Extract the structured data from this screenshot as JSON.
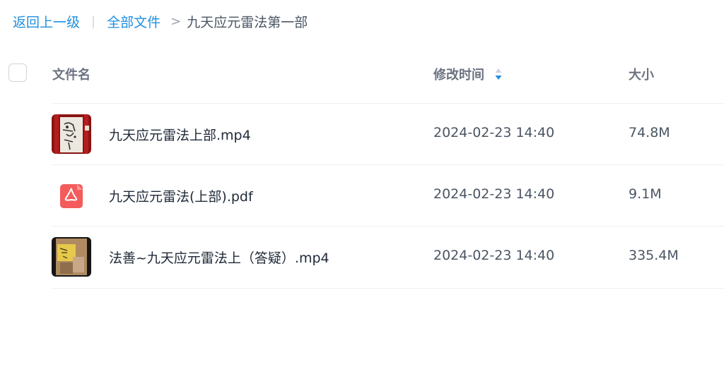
{
  "breadcrumb": {
    "back": "返回上一级",
    "divider": "|",
    "root": "全部文件",
    "separator": ">",
    "current": "九天应元雷法第一部"
  },
  "table": {
    "headers": {
      "name": "文件名",
      "modified": "修改时间",
      "size": "大小"
    },
    "sort_icon": "sort-arrows-icon",
    "rows": [
      {
        "name": "九天应元雷法上部.mp4",
        "modified": "2024-02-23 14:40",
        "size": "74.8M",
        "icon": "video-thumbnail"
      },
      {
        "name": "九天应元雷法(上部).pdf",
        "modified": "2024-02-23 14:40",
        "size": "9.1M",
        "icon": "pdf-icon"
      },
      {
        "name": "法善~九天应元雷法上（答疑）.mp4",
        "modified": "2024-02-23 14:40",
        "size": "335.4M",
        "icon": "video-thumbnail"
      }
    ]
  },
  "colors": {
    "link": "#1f8fe0",
    "pdf": "#f45b5b"
  }
}
